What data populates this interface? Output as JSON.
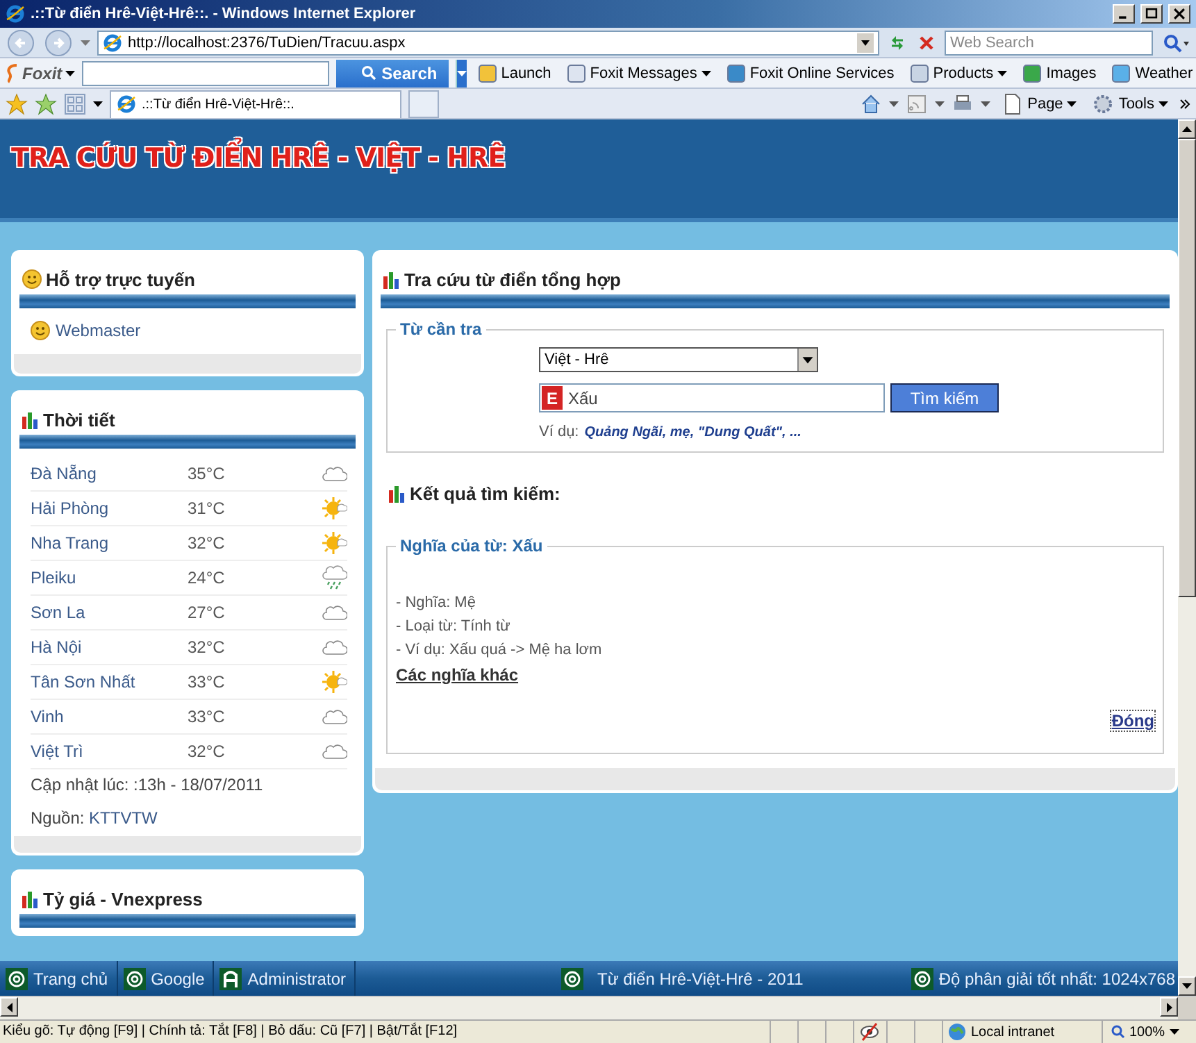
{
  "window": {
    "title": ".::Từ điển Hrê-Việt-Hrê::. - Windows Internet Explorer",
    "address": "http://localhost:2376/TuDien/Tracuu.aspx",
    "search_placeholder": "Web Search"
  },
  "foxit_toolbar": {
    "brand": "Foxit",
    "search_button": "Search",
    "items": [
      {
        "label": "Launch",
        "dropdown": false
      },
      {
        "label": "Foxit Messages",
        "dropdown": true
      },
      {
        "label": "Foxit Online Services",
        "dropdown": false
      },
      {
        "label": "Products",
        "dropdown": true
      },
      {
        "label": "Images",
        "dropdown": false
      },
      {
        "label": "Weather",
        "dropdown": false
      }
    ]
  },
  "tab_bar": {
    "tab": ".::Từ điển Hrê-Việt-Hrê::.",
    "commands": [
      {
        "label": "Page"
      },
      {
        "label": "Tools"
      }
    ]
  },
  "page": {
    "banner": "TRA CỨU TỪ ĐIỂN HRÊ - VIỆT - HRÊ",
    "support": {
      "title": "Hỗ trợ trực tuyến",
      "items": [
        "Webmaster"
      ]
    },
    "weather": {
      "title": "Thời tiết",
      "rows": [
        {
          "city": "Đà Nẵng",
          "temp": "35°C",
          "kind": "cloudy"
        },
        {
          "city": "Hải Phòng",
          "temp": "31°C",
          "kind": "sunny"
        },
        {
          "city": "Nha Trang",
          "temp": "32°C",
          "kind": "sunny"
        },
        {
          "city": "Pleiku",
          "temp": "24°C",
          "kind": "rain"
        },
        {
          "city": "Sơn La",
          "temp": "27°C",
          "kind": "cloudy"
        },
        {
          "city": "Hà Nội",
          "temp": "32°C",
          "kind": "cloudy"
        },
        {
          "city": "Tân Sơn Nhất",
          "temp": "33°C",
          "kind": "sunny"
        },
        {
          "city": "Vinh",
          "temp": "33°C",
          "kind": "cloudy"
        },
        {
          "city": "Việt Trì",
          "temp": "32°C",
          "kind": "cloudy"
        }
      ],
      "updated": "Cập nhật lúc: :13h - 18/07/2011",
      "source_label": "Nguồn:",
      "source": "KTTVTW"
    },
    "exchange": {
      "title": "Tỷ giá - Vnexpress"
    },
    "lookup": {
      "title": "Tra cứu từ điển tổng hợp",
      "legend": "Từ cần tra",
      "direction": "Việt - Hrê",
      "input_badge": "E",
      "query": "Xấu",
      "button": "Tìm kiếm",
      "example_label": "Ví dụ:",
      "examples": "Quảng Ngãi, mẹ, \"Dung Quất\", ..."
    },
    "results": {
      "title": "Kết quả tìm kiếm:",
      "legend": "Nghĩa của từ: Xấu",
      "lines": [
        "- Nghĩa: Mệ",
        "- Loại từ: Tính từ",
        "- Ví dụ: Xấu quá -> Mệ ha lơm"
      ],
      "more_link": "Các nghĩa khác",
      "close": "Đóng"
    },
    "footer": {
      "links": [
        {
          "label": "Trang chủ",
          "kind": "at"
        },
        {
          "label": "Google",
          "kind": "at"
        },
        {
          "label": "Administrator",
          "kind": "admin"
        }
      ],
      "center": "Từ điển Hrê-Việt-Hrê - 2011",
      "right": "Độ phân giải tốt nhất: 1024x768"
    }
  },
  "status_bar": {
    "text": "Kiểu gõ: Tự động [F9] | Chính tả: Tắt [F8] | Bỏ dấu: Cũ [F7] | Bật/Tắt [F12]",
    "zone": "Local intranet",
    "zoom": "100%"
  }
}
